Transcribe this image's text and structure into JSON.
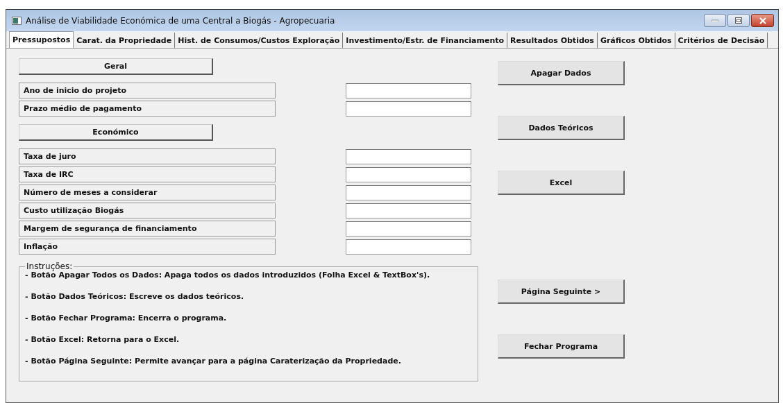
{
  "window": {
    "title": "Análise de Viabilidade Económica de uma Central a Biogás - Agropecuaria"
  },
  "tabs": [
    {
      "label": "Pressupostos",
      "selected": true
    },
    {
      "label": "Carat. da Propriedade",
      "selected": false
    },
    {
      "label": "Hist. de Consumos/Custos Exploração",
      "selected": false
    },
    {
      "label": "Investimento/Estr. de Financiamento",
      "selected": false
    },
    {
      "label": "Resultados Obtidos",
      "selected": false
    },
    {
      "label": "Gráficos Obtidos",
      "selected": false
    },
    {
      "label": "Critérios de Decisão",
      "selected": false
    }
  ],
  "sections": [
    {
      "heading": "Geral",
      "fields": [
        "Ano de inicio do projeto",
        "Prazo médio de pagamento"
      ]
    },
    {
      "heading": "Económico",
      "fields": [
        "Taxa de juro",
        "Taxa de IRC",
        "Número de meses a considerar",
        "Custo utilização Biogás",
        "Margem de segurança de financiamento",
        "Inflação"
      ]
    }
  ],
  "instructions": {
    "title": "Instruções:",
    "lines": [
      "- Botão Apagar Todos os Dados: Apaga todos os dados introduzidos (Folha Excel & TextBox's).",
      "- Botão Dados Teóricos: Escreve os dados teóricos.",
      "- Botão Fechar Programa: Encerra o programa.",
      "- Botão Excel: Retorna para o Excel.",
      "- Botão Página Seguinte: Permite avançar para a página Caraterização da Propriedade."
    ]
  },
  "buttons": [
    "Apagar Dados",
    "Dados Teóricos",
    "Excel",
    "Página Seguinte >",
    "Fechar Programa"
  ]
}
